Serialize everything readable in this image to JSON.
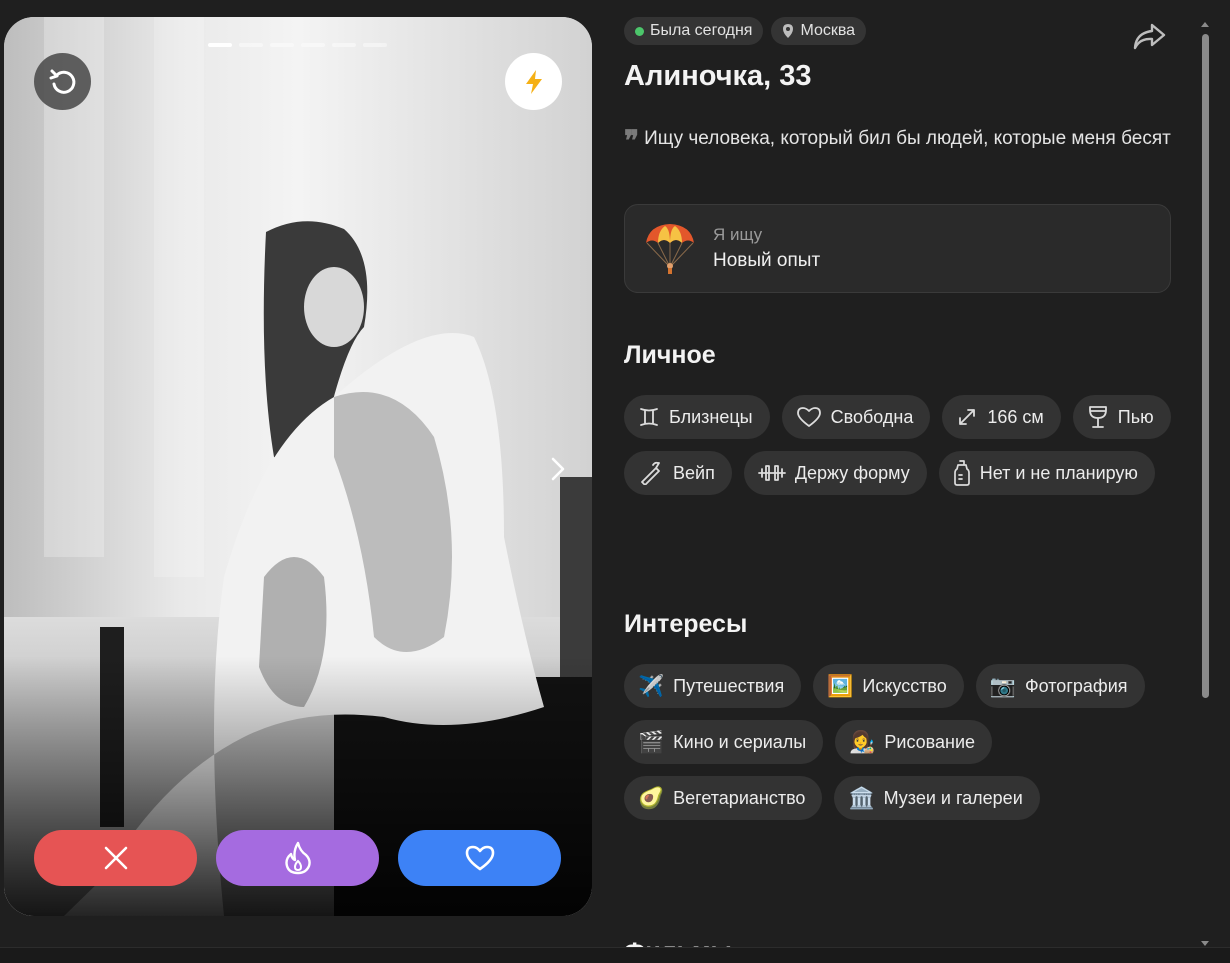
{
  "photo": {
    "total": 6,
    "active_index": 0,
    "alt": "Фото профиля"
  },
  "status": {
    "online_text": "Была сегодня",
    "online_color": "#4cc66b",
    "city": "Москва"
  },
  "profile": {
    "name_age": "Алиночка, 33",
    "bio": "Ищу человека, который бил бы людей, которые меня бесят",
    "seeking_label": "Я ищу",
    "seeking_value": "Новый опыт"
  },
  "sections": {
    "personal_title": "Личное",
    "interests_title": "Интересы",
    "next_title": "Фильмы"
  },
  "personal": [
    {
      "icon": "gemini-icon",
      "label": "Близнецы"
    },
    {
      "icon": "heart-outline-icon",
      "label": "Свободна"
    },
    {
      "icon": "height-icon",
      "label": "166 см"
    },
    {
      "icon": "wine-glass-icon",
      "label": "Пью"
    },
    {
      "icon": "vape-icon",
      "label": "Вейп"
    },
    {
      "icon": "dumbbell-icon",
      "label": "Держу форму"
    },
    {
      "icon": "baby-bottle-icon",
      "label": "Нет и не планирую"
    }
  ],
  "interests": [
    {
      "emoji": "✈️",
      "label": "Путешествия"
    },
    {
      "emoji": "🖼️",
      "label": "Искусство"
    },
    {
      "emoji": "📷",
      "label": "Фотография"
    },
    {
      "emoji": "🎬",
      "label": "Кино и сериалы"
    },
    {
      "emoji": "👩‍🎨",
      "label": "Рисование"
    },
    {
      "emoji": "🥑",
      "label": "Вегетарианство"
    },
    {
      "emoji": "🏛️",
      "label": "Музеи и галереи"
    }
  ],
  "colors": {
    "dislike": "#e65454",
    "superlike": "#a56be0",
    "like": "#3d82f6",
    "boost": "#f5b015"
  }
}
